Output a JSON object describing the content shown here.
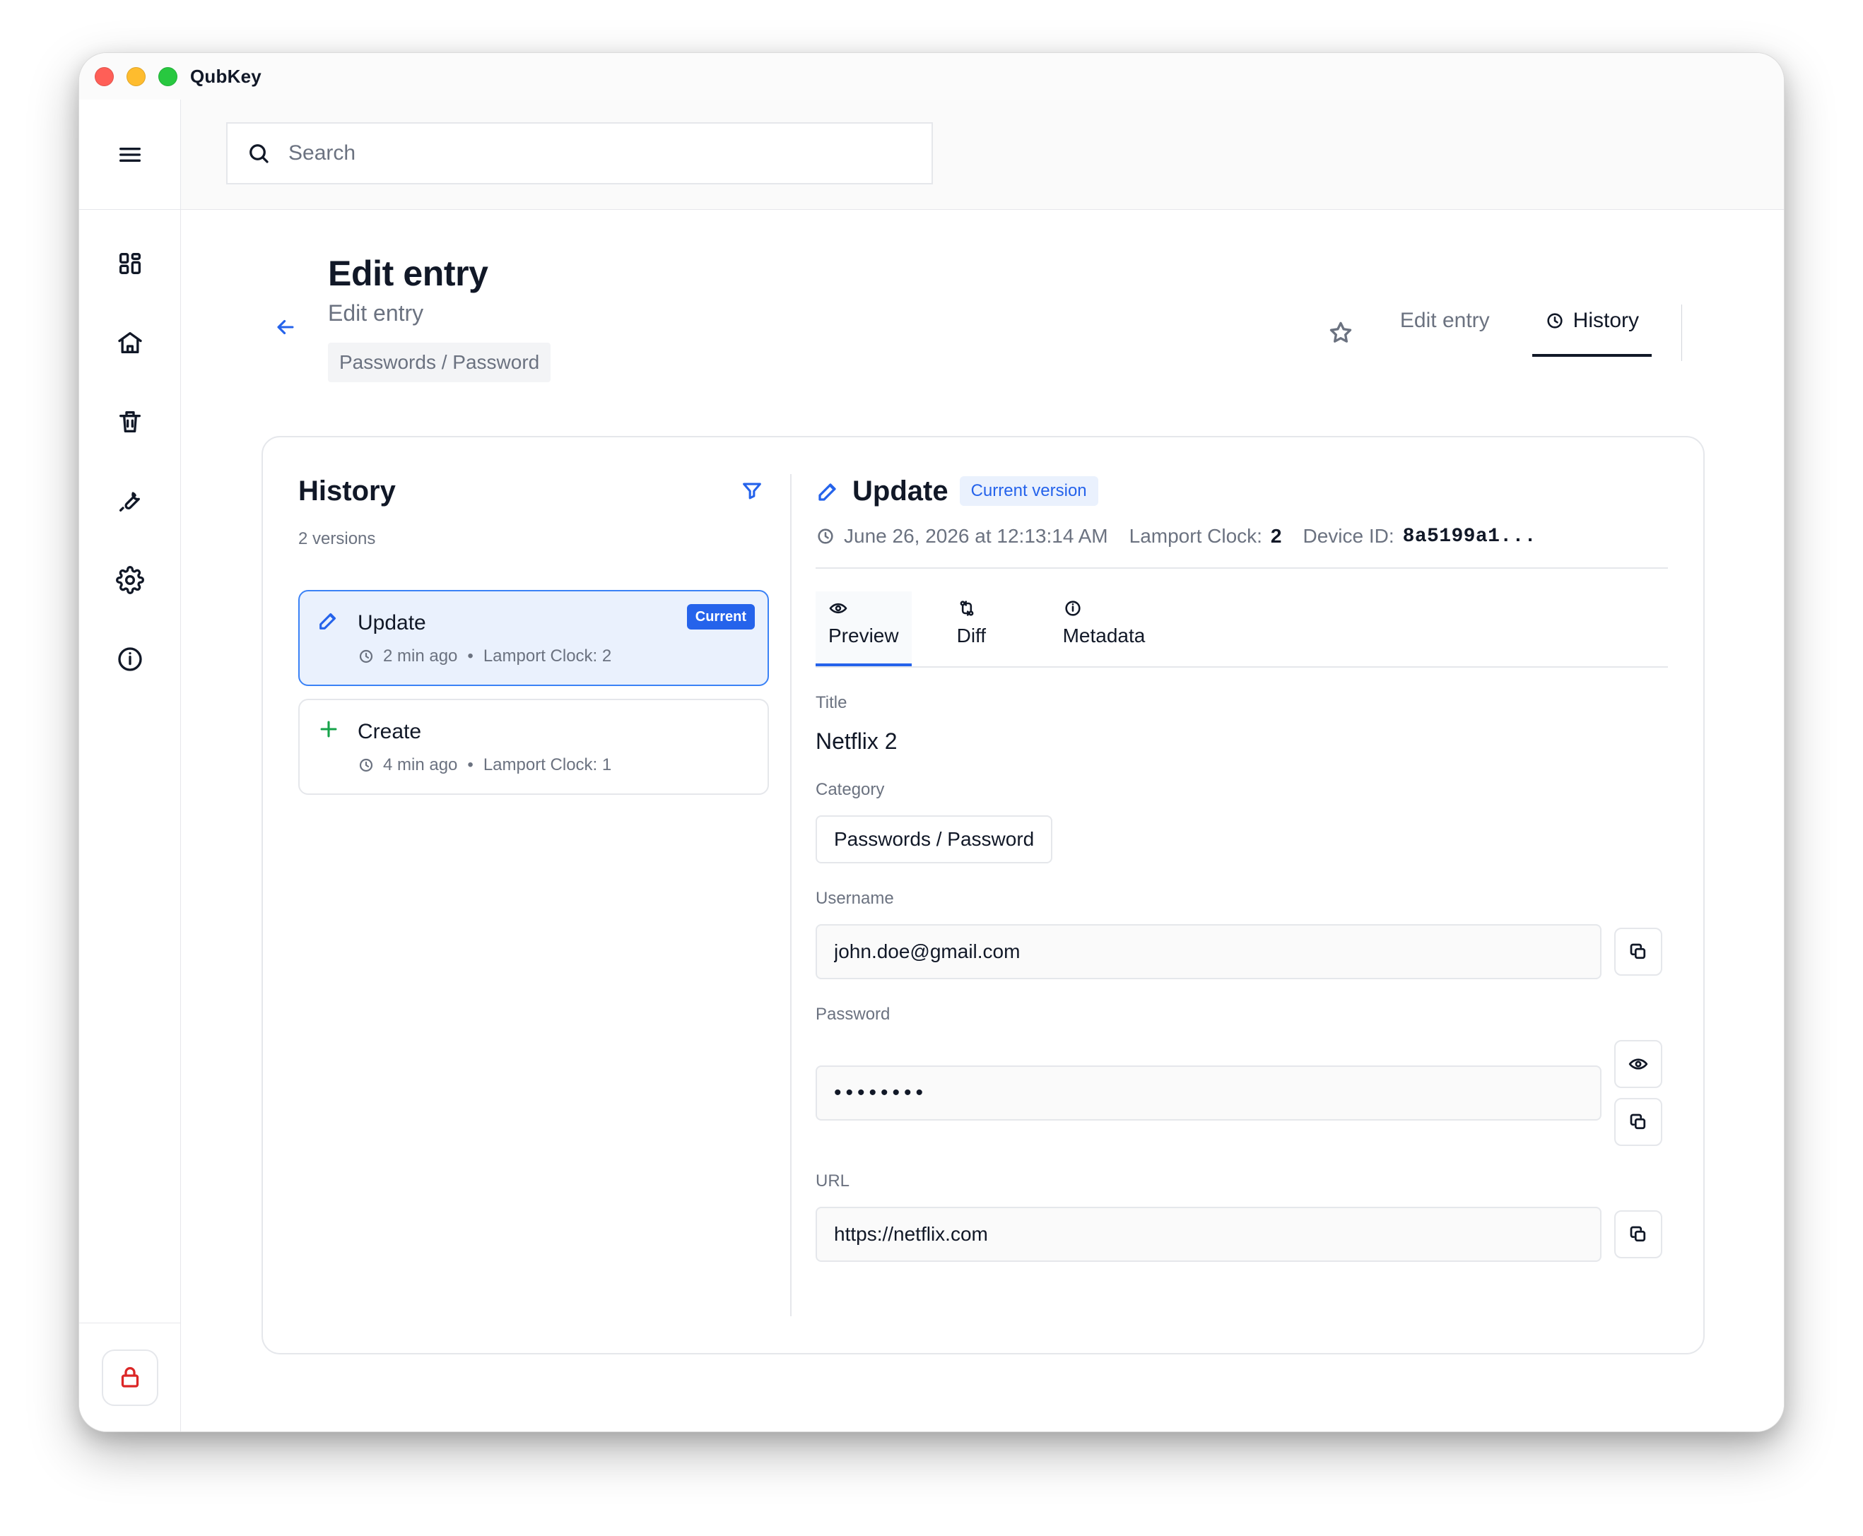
{
  "window": {
    "title": "QubKey"
  },
  "search": {
    "placeholder": "Search"
  },
  "header": {
    "title": "Edit entry",
    "subtitle": "Edit entry",
    "category": "Passwords / Password",
    "tabs": [
      {
        "label": "Edit entry"
      },
      {
        "label": "History"
      }
    ]
  },
  "history": {
    "title": "History",
    "count": "2 versions",
    "items": [
      {
        "title": "Update",
        "time": "2 min ago",
        "lamport": "Lamport Clock: 2",
        "badge": "Current"
      },
      {
        "title": "Create",
        "time": "4 min ago",
        "lamport": "Lamport Clock: 1"
      }
    ]
  },
  "detail": {
    "title": "Update",
    "badge": "Current version",
    "date": "June 26, 2026 at 12:13:14 AM",
    "lamport_label": "Lamport Clock:",
    "lamport_value": "2",
    "device_label": "Device ID:",
    "device_value": "8a5199a1...",
    "tabs": [
      {
        "label": "Preview"
      },
      {
        "label": "Diff"
      },
      {
        "label": "Metadata"
      }
    ],
    "fields": {
      "title_label": "Title",
      "title_value": "Netflix 2",
      "category_label": "Category",
      "category_value": "Passwords / Password",
      "username_label": "Username",
      "username_value": "john.doe@gmail.com",
      "password_label": "Password",
      "password_value": "••••••••",
      "url_label": "URL",
      "url_value": "https://netflix.com"
    }
  },
  "colors": {
    "accent": "#2563eb",
    "selected_bg": "#eaf1fd",
    "danger": "#dc2626",
    "success": "#16a34a"
  },
  "icons": {
    "menu": "menu-icon",
    "dashboard": "dashboard-icon",
    "home": "home-icon",
    "trash": "trash-icon",
    "tool": "wrench-icon",
    "settings": "gear-icon",
    "info": "info-icon",
    "lock": "lock-icon",
    "search": "search-icon",
    "back": "arrow-left-icon",
    "favorite": "star-icon",
    "history": "clock-icon",
    "filter": "filter-icon",
    "edit": "edit-icon",
    "create": "plus-icon",
    "preview": "eye-icon",
    "diff": "diff-icon",
    "metadata": "info-icon",
    "copy": "copy-icon",
    "reveal": "eye-icon"
  }
}
